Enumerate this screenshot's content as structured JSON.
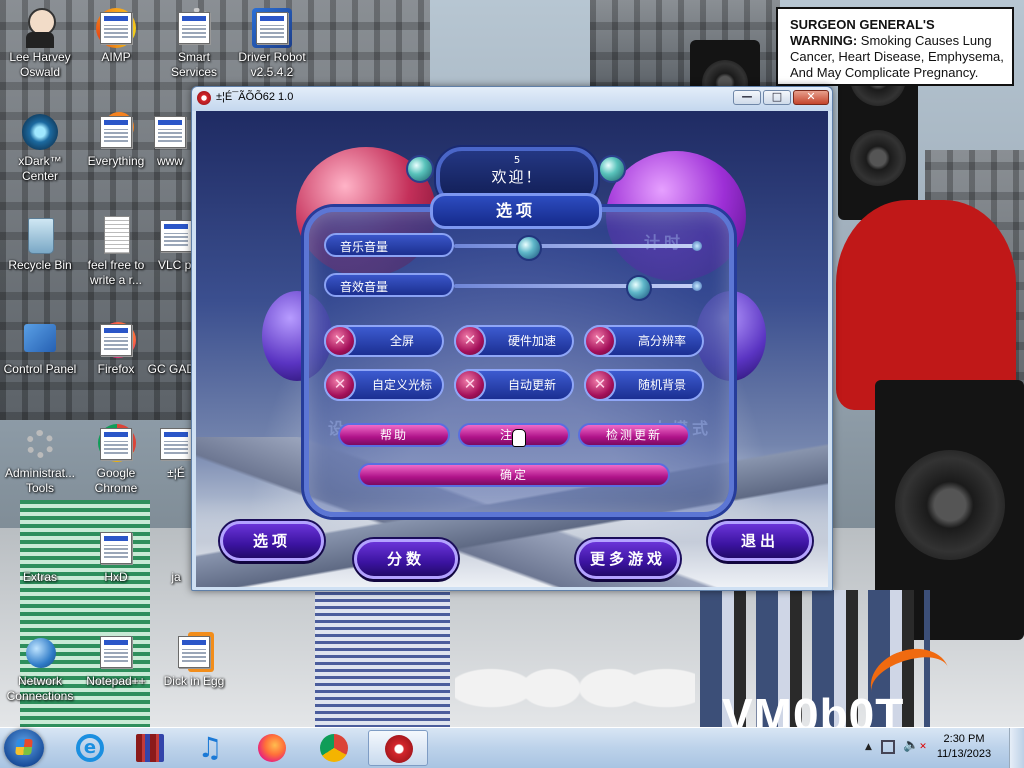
{
  "desktop": {
    "warning": {
      "bold": "SURGEON GENERAL'S WARNING:",
      "text": "Smoking Causes Lung Cancer, Heart Disease, Emphysema, And May Complicate Pregnancy."
    },
    "watermark": "VM0b0T",
    "icons": [
      {
        "label": "Lee Harvey Oswald",
        "icon": "person-icon"
      },
      {
        "label": "AIMP",
        "icon": "aimp-icon"
      },
      {
        "label": "Smart Services",
        "icon": "services-icon"
      },
      {
        "label": "Driver Robot v2.5.4.2",
        "icon": "driver-robot-icon"
      },
      {
        "label": "xDark™ Center",
        "icon": "xdark-icon"
      },
      {
        "label": "Everything",
        "icon": "everything-icon"
      },
      {
        "label": "www",
        "icon": "file-icon"
      },
      {
        "label": "Recycle Bin",
        "icon": "recycle-bin-icon"
      },
      {
        "label": "feel free to write a r...",
        "icon": "text-document-icon"
      },
      {
        "label": "VLC pl",
        "icon": "vlc-icon"
      },
      {
        "label": "Control Panel",
        "icon": "control-panel-icon"
      },
      {
        "label": "Firefox",
        "icon": "firefox-icon"
      },
      {
        "label": "GC GADG",
        "icon": "gadget-icon"
      },
      {
        "label": "Administrat... Tools",
        "icon": "admin-tools-icon"
      },
      {
        "label": "Google Chrome",
        "icon": "chrome-icon"
      },
      {
        "label": "±¦É",
        "icon": "game-shortcut-icon"
      },
      {
        "label": "Extras",
        "icon": "extras-icon"
      },
      {
        "label": "HxD",
        "icon": "hxd-icon"
      },
      {
        "label": "ja",
        "icon": "file-icon"
      },
      {
        "label": "Network Connections",
        "icon": "network-icon"
      },
      {
        "label": "Notepad++",
        "icon": "notepadpp-icon"
      },
      {
        "label": "Dick in Egg",
        "icon": "dick-in-egg-icon"
      }
    ]
  },
  "window": {
    "title": "±¦É¯ÃÕÕ62 1.0",
    "controls": {
      "minimize": "—",
      "maximize": "□",
      "close": "✕"
    }
  },
  "game": {
    "welcome_number": "5",
    "welcome_text": "欢迎！",
    "options_title": "选项",
    "ghost_right": "计时",
    "ghost_left_bottom": "设",
    "ghost_right_bottom": "人模式",
    "sliders": [
      {
        "label": "音乐音量",
        "value": 0.3
      },
      {
        "label": "音效音量",
        "value": 0.75
      }
    ],
    "toggles": [
      {
        "label": "全屏"
      },
      {
        "label": "硬件加速"
      },
      {
        "label": "高分辨率"
      },
      {
        "label": "自定义光标"
      },
      {
        "label": "自动更新"
      },
      {
        "label": "随机背景"
      }
    ],
    "buttons": {
      "help": "帮助",
      "register": "注册",
      "check_update": "检测更新",
      "ok": "确定"
    },
    "main_buttons": {
      "options": "选项",
      "scores": "分数",
      "more_games": "更多游戏",
      "quit": "退出"
    }
  },
  "taskbar": {
    "apps": [
      "internet-explorer-icon",
      "archive-icon",
      "music-icon",
      "firefox-icon",
      "chrome-icon",
      "game-icon"
    ],
    "time": "2:30 PM",
    "date": "11/13/2023"
  }
}
